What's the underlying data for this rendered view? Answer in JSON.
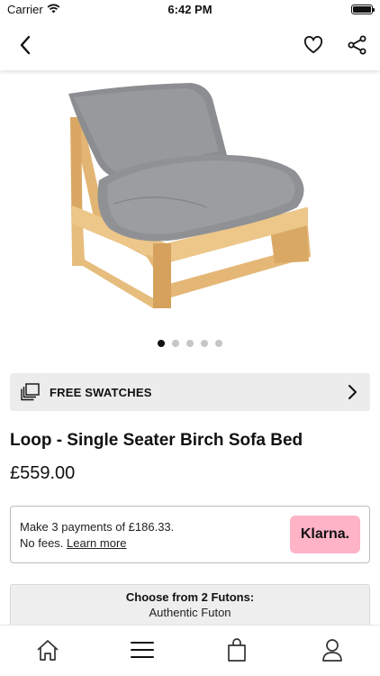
{
  "status_bar": {
    "carrier": "Carrier",
    "time": "6:42 PM",
    "battery_level": 1.0
  },
  "nav": {
    "back_icon": "chevron-left-icon",
    "favorite_icon": "heart-icon",
    "share_icon": "share-icon"
  },
  "carousel": {
    "image_subject": "single seater birch sofa bed with grey futon",
    "dot_count": 5,
    "active_index": 0
  },
  "swatches": {
    "icon": "swatches-icon",
    "label": "FREE SWATCHES",
    "chevron_icon": "chevron-right-icon"
  },
  "product": {
    "title": "Loop - Single Seater Birch Sofa Bed",
    "price": "£559.00"
  },
  "klarna": {
    "line1": "Make 3 payments of £186.33.",
    "line2_prefix": "No fees. ",
    "learn_more": "Learn more",
    "badge": "Klarna.",
    "badge_color": "#FFB3C7"
  },
  "futon": {
    "title": "Choose from 2 Futons:",
    "selected": "Authentic Futon"
  },
  "tab_bar": {
    "items": [
      "home-icon",
      "menu-icon",
      "bag-icon",
      "account-icon"
    ]
  }
}
